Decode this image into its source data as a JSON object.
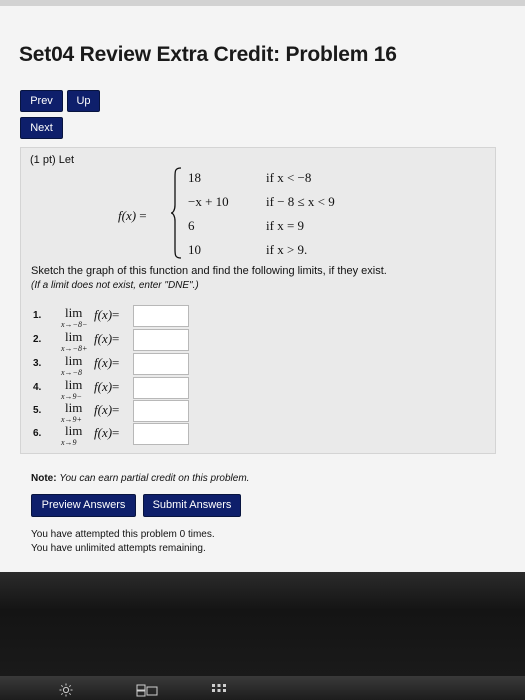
{
  "page": {
    "title": "Set04 Review Extra Credit: Problem 16"
  },
  "nav": {
    "prev": "Prev",
    "up": "Up",
    "next": "Next"
  },
  "problem": {
    "points": "(1 pt) Let",
    "function_label": "f(x)",
    "equals": "=",
    "cases": [
      {
        "value": "18",
        "condition": "if x < −8"
      },
      {
        "value": "−x + 10",
        "condition": "if  − 8 ≤ x < 9"
      },
      {
        "value": "6",
        "condition": "if x = 9"
      },
      {
        "value": "10",
        "condition": "if x > 9."
      }
    ],
    "instruction": "Sketch the graph of this function and find the following limits, if they exist.",
    "dne_hint": "(If a limit does not exist, enter \"DNE\".)",
    "limits": [
      {
        "number": "1.",
        "lim": "lim",
        "approach": "x→−8−",
        "expr": "f(x)",
        "equals": "=",
        "answer": ""
      },
      {
        "number": "2.",
        "lim": "lim",
        "approach": "x→−8+",
        "expr": "f(x)",
        "equals": "=",
        "answer": ""
      },
      {
        "number": "3.",
        "lim": "lim",
        "approach": "x→−8",
        "expr": "f(x)",
        "equals": "=",
        "answer": ""
      },
      {
        "number": "4.",
        "lim": "lim",
        "approach": "x→9−",
        "expr": "f(x)",
        "equals": "=",
        "answer": ""
      },
      {
        "number": "5.",
        "lim": "lim",
        "approach": "x→9+",
        "expr": "f(x)",
        "equals": "=",
        "answer": ""
      },
      {
        "number": "6.",
        "lim": "lim",
        "approach": "x→9",
        "expr": "f(x)",
        "equals": "=",
        "answer": ""
      }
    ],
    "note_label": "Note:",
    "note_text": "You can earn partial credit on this problem."
  },
  "actions": {
    "preview": "Preview Answers",
    "submit": "Submit Answers"
  },
  "status": {
    "attempted": "You have attempted this problem 0 times.",
    "remaining": "You have unlimited attempts remaining."
  },
  "colors": {
    "button_bg": "#0e1f6b",
    "panel_bg": "#eaeaea",
    "page_bg": "#f4f4f4"
  },
  "icons": [
    "brightness-icon",
    "mission-control-icon",
    "launchpad-icon"
  ]
}
